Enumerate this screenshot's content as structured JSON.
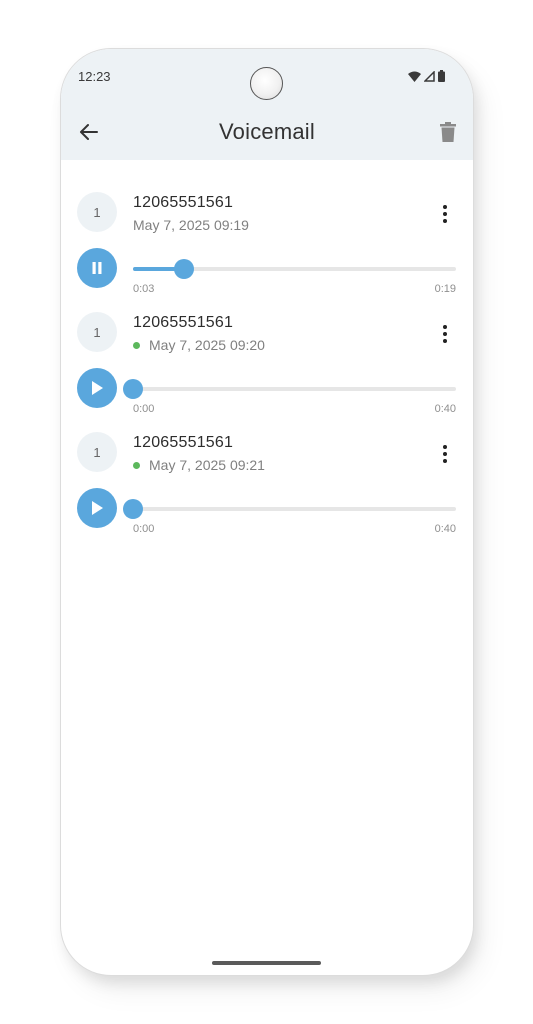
{
  "status_bar": {
    "time": "12:23"
  },
  "app_bar": {
    "title": "Voicemail"
  },
  "voicemails": [
    {
      "avatar": "1",
      "number": "12065551561",
      "date": "May 7, 2025 09:19",
      "is_new": false,
      "state": "playing",
      "position_label": "0:03",
      "duration_label": "0:19",
      "progress": 0.158
    },
    {
      "avatar": "1",
      "number": "12065551561",
      "date": "May 7, 2025 09:20",
      "is_new": true,
      "state": "paused",
      "position_label": "0:00",
      "duration_label": "0:40",
      "progress": 0
    },
    {
      "avatar": "1",
      "number": "12065551561",
      "date": "May 7, 2025 09:21",
      "is_new": true,
      "state": "paused",
      "position_label": "0:00",
      "duration_label": "0:40",
      "progress": 0
    }
  ],
  "colors": {
    "accent": "#5aa7dd",
    "new_indicator": "#5cb85c",
    "app_bar_bg": "#edf2f5"
  }
}
